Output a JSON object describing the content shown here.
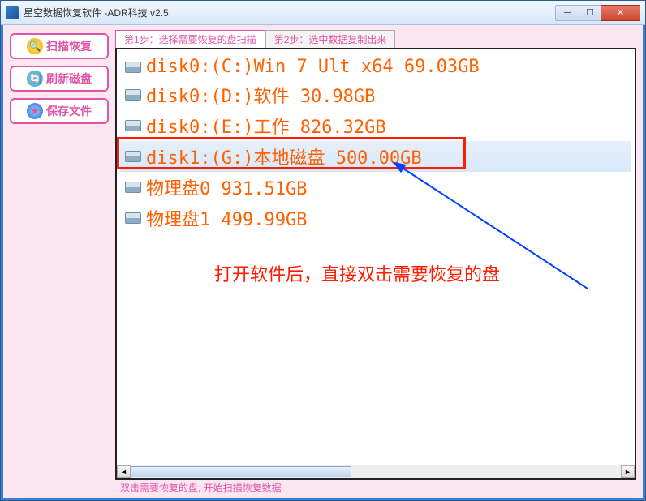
{
  "window": {
    "title": "星空数据恢复软件   -ADR科技 v2.5"
  },
  "sidebar": {
    "scan_label": "扫描恢复",
    "refresh_label": "刷新磁盘",
    "save_label": "保存文件"
  },
  "tabs": {
    "step1": "第1步：选择需要恢复的盘扫描",
    "step2": "第2步：选中数据复制出来"
  },
  "disks": [
    {
      "label": "disk0:(C:)Win 7 Ult x64 69.03GB",
      "selected": false
    },
    {
      "label": "disk0:(D:)软件 30.98GB",
      "selected": false
    },
    {
      "label": "disk0:(E:)工作 826.32GB",
      "selected": false
    },
    {
      "label": "disk1:(G:)本地磁盘 500.00GB",
      "selected": true
    },
    {
      "label": "物理盘0 931.51GB",
      "selected": false
    },
    {
      "label": "物理盘1 499.99GB",
      "selected": false
    }
  ],
  "annotation_text": "打开软件后，直接双击需要恢复的盘",
  "status_text": "双击需要恢复的盘, 开始扫描恢复数据",
  "colors": {
    "accent_pink": "#e055a6",
    "disk_text": "#ff6000",
    "highlight_red": "#ff1c00",
    "window_blue": "#3b7fd1"
  }
}
